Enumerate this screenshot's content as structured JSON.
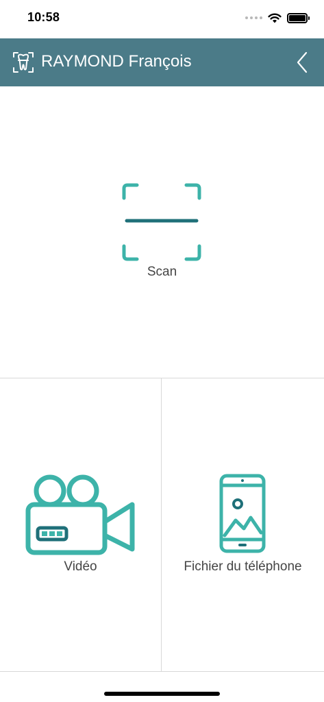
{
  "status_bar": {
    "time": "10:58"
  },
  "header": {
    "title": "RAYMOND François",
    "logo_icon": "tooth-scan-icon",
    "back_icon": "chevron-left-icon",
    "background": "#4b7b88"
  },
  "actions": {
    "scan": {
      "label": "Scan",
      "icon": "scan-frame-icon"
    },
    "video": {
      "label": "Vidéo",
      "icon": "video-camera-icon"
    },
    "phone_file": {
      "label": "Fichier du téléphone",
      "icon": "phone-gallery-icon"
    }
  },
  "colors": {
    "accent": "#3db3a9",
    "accent_dark": "#1f7079"
  }
}
